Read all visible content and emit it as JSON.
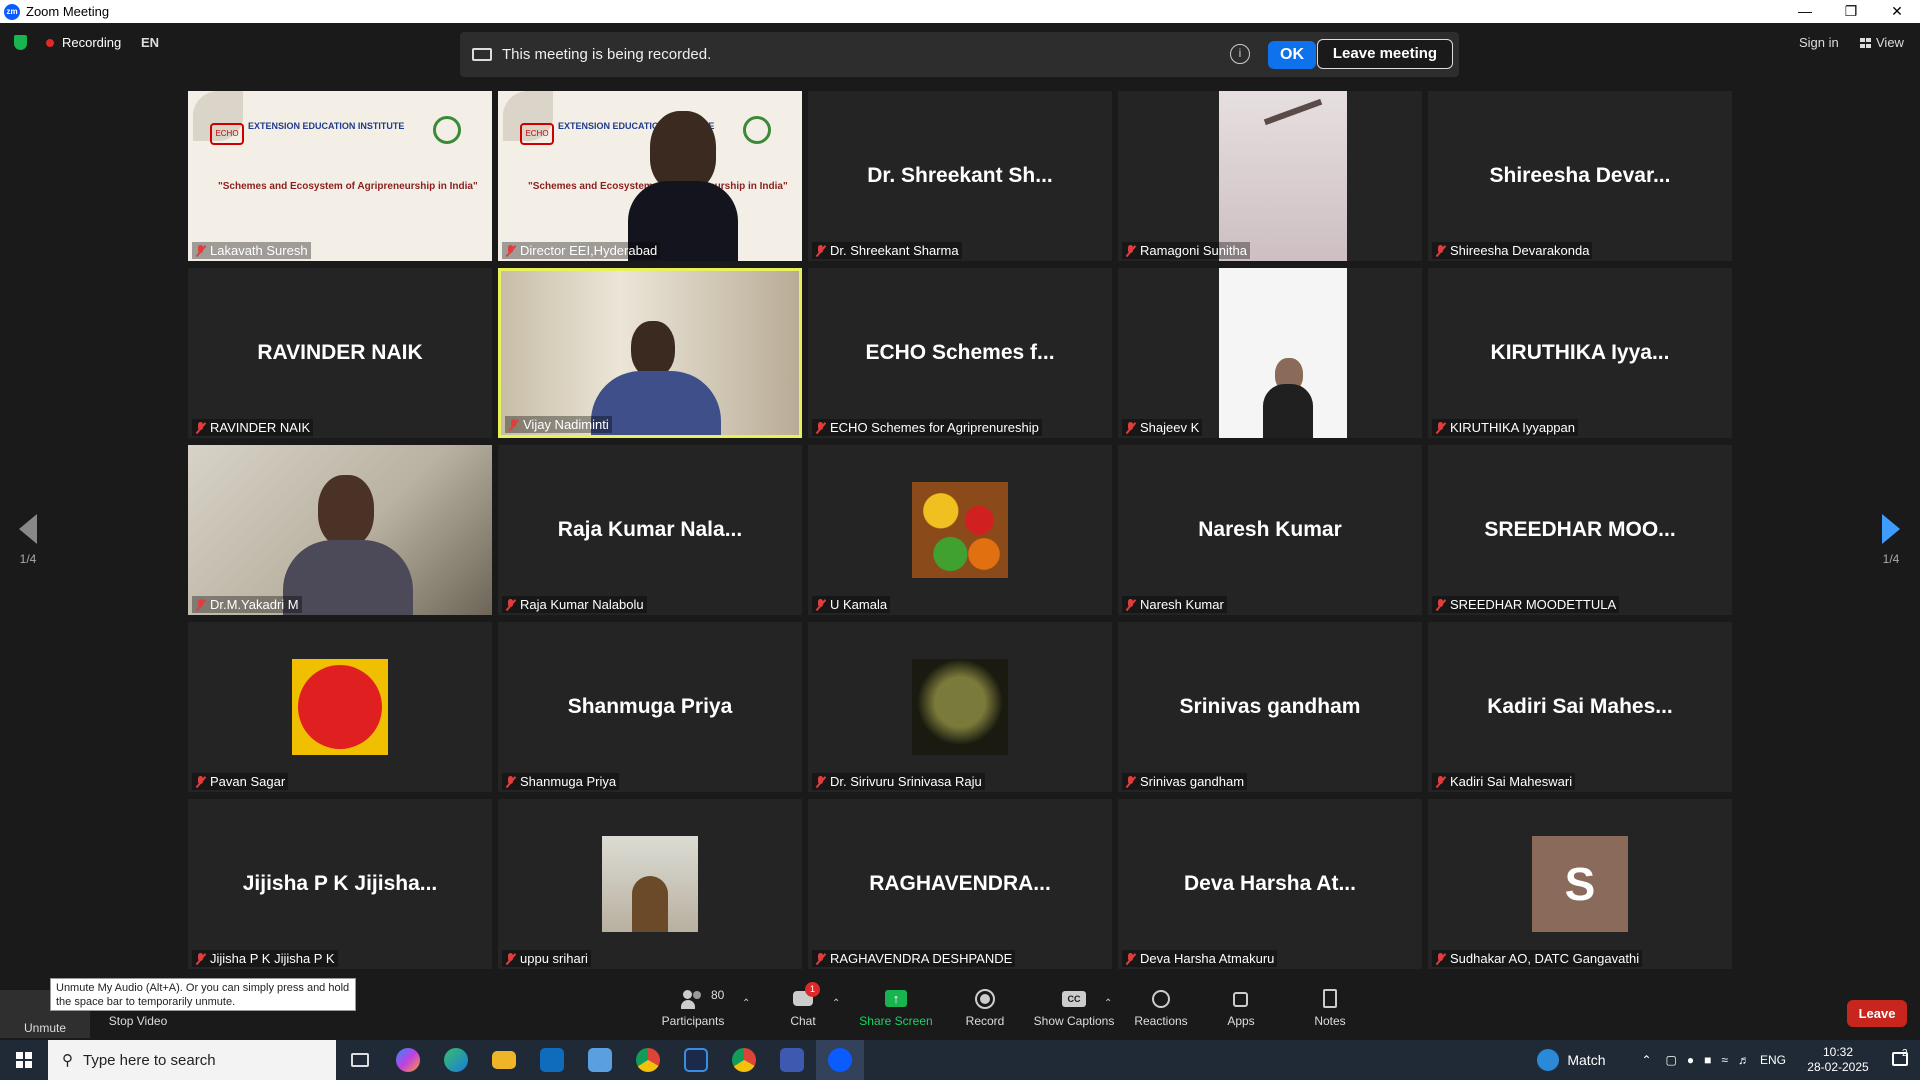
{
  "window": {
    "title": "Zoom Meeting",
    "logo_text": "zm",
    "controls": [
      "—",
      "❐",
      "✕"
    ]
  },
  "topbar": {
    "recording_label": "Recording",
    "language": "EN",
    "banner_message": "This meeting is being recorded.",
    "info_icon": "i",
    "ok_label": "OK",
    "leave_meeting_label": "Leave meeting",
    "sign_in_label": "Sign in",
    "view_label": "View"
  },
  "pagination": {
    "prev_page": "1/4",
    "next_page": "1/4"
  },
  "tiles": [
    {
      "name": "Lakavath Suresh",
      "big": "",
      "kind": "poster"
    },
    {
      "name": "Director EEI,Hyderabad",
      "big": "",
      "kind": "poster-person"
    },
    {
      "name": "Dr. Shreekant Sharma",
      "big": "Dr. Shreekant Sh...",
      "kind": "text"
    },
    {
      "name": "Ramagoni Sunitha",
      "big": "",
      "kind": "ceiling"
    },
    {
      "name": "Shireesha Devarakonda",
      "big": "Shireesha Devar...",
      "kind": "text"
    },
    {
      "name": "RAVINDER NAIK",
      "big": "RAVINDER NAIK",
      "kind": "text"
    },
    {
      "name": "Vijay Nadiminti",
      "big": "",
      "kind": "office",
      "active": true
    },
    {
      "name": "ECHO Schemes for Agriprenureship",
      "big": "ECHO Schemes f...",
      "kind": "text"
    },
    {
      "name": "Shajeev K",
      "big": "",
      "kind": "white"
    },
    {
      "name": "KIRUTHIKA Iyyappan",
      "big": "KIRUTHIKA Iyya...",
      "kind": "text"
    },
    {
      "name": "Dr.M.Yakadri M",
      "big": "",
      "kind": "room"
    },
    {
      "name": "Raja Kumar Nalabolu",
      "big": "Raja Kumar Nala...",
      "kind": "text"
    },
    {
      "name": "U Kamala",
      "big": "",
      "kind": "fruits"
    },
    {
      "name": "Naresh Kumar",
      "big": "Naresh Kumar",
      "kind": "text"
    },
    {
      "name": "SREEDHAR MOODETTULA",
      "big": "SREEDHAR MOO...",
      "kind": "text"
    },
    {
      "name": "Pavan Sagar",
      "big": "",
      "kind": "pawan"
    },
    {
      "name": "Shanmuga Priya",
      "big": "Shanmuga Priya",
      "kind": "text"
    },
    {
      "name": "Dr. Sirivuru Srinivasa Raju",
      "big": "",
      "kind": "kshatriya"
    },
    {
      "name": "Srinivas gandham",
      "big": "Srinivas gandham",
      "kind": "text"
    },
    {
      "name": "Kadiri Sai Maheswari",
      "big": "Kadiri Sai Mahes...",
      "kind": "text"
    },
    {
      "name": "Jijisha P K Jijisha P K",
      "big": "Jijisha P K Jijisha...",
      "kind": "text"
    },
    {
      "name": "uppu srihari",
      "big": "",
      "kind": "kid"
    },
    {
      "name": "RAGHAVENDRA DESHPANDE",
      "big": "RAGHAVENDRA...",
      "kind": "text"
    },
    {
      "name": "Deva Harsha Atmakuru",
      "big": "Deva Harsha At...",
      "kind": "text"
    },
    {
      "name": "Sudhakar AO, DATC Gangavathi",
      "big": "",
      "kind": "s-avatar",
      "initial": "S"
    }
  ],
  "poster": {
    "line1": "EXTENSION EDUCATION INSTITUTE",
    "line2": "\"Schemes and Ecosystem of Agripreneurship in India\"",
    "logo": "ECHO"
  },
  "toolbar": {
    "unmute": "Unmute",
    "stop_video": "Stop Video",
    "participants": "Participants",
    "participants_count": "80",
    "chat": "Chat",
    "chat_badge": "1",
    "share_screen": "Share Screen",
    "record": "Record",
    "show_captions": "Show Captions",
    "captions_icon": "CC",
    "reactions": "Reactions",
    "apps": "Apps",
    "notes": "Notes",
    "leave": "Leave",
    "tooltip": "Unmute My Audio (Alt+A). Or you can simply press and hold the space bar to temporarily unmute."
  },
  "taskbar": {
    "search_placeholder": "Type here to search",
    "weather_label": "Match",
    "lang": "ENG",
    "time": "10:32",
    "date": "28-02-2025",
    "notification_count": "2"
  },
  "colors": {
    "accent": "#0e72ed",
    "leave": "#c8251e",
    "recording": "#e02828",
    "active_speaker": "#e8f05a",
    "next_arrow": "#3e9cff"
  }
}
